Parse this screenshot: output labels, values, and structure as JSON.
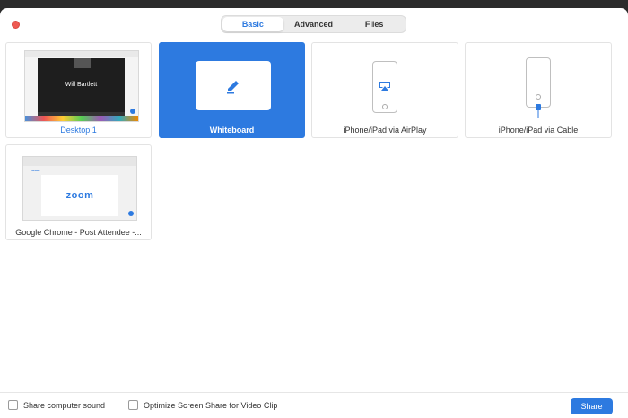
{
  "tabs": [
    {
      "label": "Basic",
      "active": true
    },
    {
      "label": "Advanced",
      "active": false
    },
    {
      "label": "Files",
      "active": false
    }
  ],
  "tiles": {
    "desktop": {
      "label": "Desktop 1",
      "preview_name": "Will Bartlett"
    },
    "whiteboard": {
      "label": "Whiteboard",
      "icon": "pencil-icon"
    },
    "airplay": {
      "label": "iPhone/iPad via AirPlay",
      "icon": "airplay-icon"
    },
    "cable": {
      "label": "iPhone/iPad via Cable",
      "icon": "cable-icon"
    },
    "chrome": {
      "label": "Google Chrome - Post Attendee -...",
      "preview_logo": "zoom",
      "preview_logo_small": "zoom"
    }
  },
  "footer": {
    "share_sound": {
      "label": "Share computer sound",
      "checked": false
    },
    "optimize_video": {
      "label": "Optimize Screen Share for Video Clip",
      "checked": false
    },
    "share_button": "Share"
  },
  "colors": {
    "accent": "#2d7ae0",
    "close": "#ee5a52"
  }
}
